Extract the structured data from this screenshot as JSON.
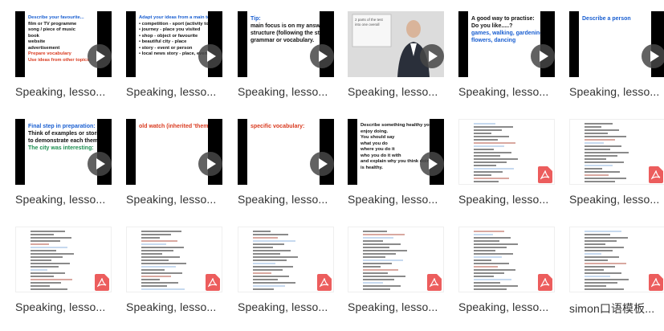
{
  "colors": {
    "blue": "#1a5fd1",
    "red": "#d93a1f",
    "green": "#1e8f52",
    "pdf": "#ec5d5d"
  },
  "items": [
    {
      "caption": "Speaking, lesso...",
      "type": "video",
      "slide": [
        {
          "t": "Describe your favourite...",
          "c": "blue"
        },
        {
          "t": " film or TV programme",
          "c": "black"
        },
        {
          "t": " song / piece of music",
          "c": "black"
        },
        {
          "t": " book",
          "c": "black"
        },
        {
          "t": " website",
          "c": "black"
        },
        {
          "t": " advertisement",
          "c": "black"
        },
        {
          "t": "Prepare vocabulary",
          "c": "red"
        },
        {
          "t": "Use ideas from other topics",
          "c": "red"
        }
      ]
    },
    {
      "caption": "Speaking, lesso...",
      "type": "video",
      "slide": [
        {
          "t": "Adapt your ideas from a main topic",
          "c": "blue"
        },
        {
          "t": "• competition - sport (activity topic)",
          "c": "black"
        },
        {
          "t": "• journey - place you visited",
          "c": "black"
        },
        {
          "t": "• shop - object or favourite",
          "c": "black"
        },
        {
          "t": "• beautiful city - place",
          "c": "black"
        },
        {
          "t": "• story - event or person",
          "c": "black"
        },
        {
          "t": "• local news story - place, event",
          "c": "black"
        }
      ]
    },
    {
      "caption": "Speaking, lesso...",
      "type": "video",
      "slide": [
        {
          "t": "Tip:",
          "c": "blue"
        },
        {
          "t": "main focus is on my answer",
          "c": "black"
        },
        {
          "t": "structure (following the steps), not",
          "c": "black"
        },
        {
          "t": "grammar or vocabulary.",
          "c": "black"
        }
      ]
    },
    {
      "caption": "Speaking, lesso...",
      "type": "person",
      "slide": [
        {
          "t": "2 parts of the test",
          "c": "black"
        },
        {
          "t": "into one overall",
          "c": "black"
        }
      ]
    },
    {
      "caption": "Speaking, lesso...",
      "type": "video",
      "slide": [
        {
          "t": "A good way to practise:",
          "c": "black"
        },
        {
          "t": "Do you like.....?",
          "c": "black"
        },
        {
          "t": "games, walking, gardening,",
          "c": "blue"
        },
        {
          "t": "flowers, dancing",
          "c": "blue"
        }
      ]
    },
    {
      "caption": "Speaking, lesso...",
      "type": "video",
      "slide": [
        {
          "t": "Describe a person",
          "c": "blue"
        }
      ]
    },
    {
      "caption": "Speaking, lesso...",
      "type": "video",
      "slide": [
        {
          "t": "Final step in preparation:",
          "c": "blue"
        },
        {
          "t": "Think of examples or stories",
          "c": "black"
        },
        {
          "t": "to demonstrate each theme",
          "c": "black"
        },
        {
          "t": "The city was interesting:",
          "c": "green"
        }
      ]
    },
    {
      "caption": "Speaking, lesso...",
      "type": "video",
      "slide": [
        {
          "t": "old watch (inherited 'theme')",
          "c": "red"
        }
      ]
    },
    {
      "caption": "Speaking, lesso...",
      "type": "video",
      "slide": [
        {
          "t": "specific vocabulary:",
          "c": "red"
        }
      ]
    },
    {
      "caption": "Speaking, lesso...",
      "type": "video",
      "slide": [
        {
          "t": "Describe something healthy you",
          "c": "black"
        },
        {
          "t": "enjoy doing.",
          "c": "black"
        },
        {
          "t": "You should say",
          "c": "black"
        },
        {
          "t": "  what you do",
          "c": "black"
        },
        {
          "t": "  where you do it",
          "c": "black"
        },
        {
          "t": "  who you do it with",
          "c": "black"
        },
        {
          "t": "and explain why you think doing it",
          "c": "black"
        },
        {
          "t": "is healthy.",
          "c": "black"
        }
      ]
    },
    {
      "caption": "Speaking, lesso...",
      "type": "pdf"
    },
    {
      "caption": "Speaking, lesso...",
      "type": "pdf"
    },
    {
      "caption": "Speaking, lesso...",
      "type": "pdf"
    },
    {
      "caption": "Speaking, lesso...",
      "type": "pdf"
    },
    {
      "caption": "Speaking, lesso...",
      "type": "pdf"
    },
    {
      "caption": "Speaking, lesso...",
      "type": "pdf"
    },
    {
      "caption": "Speaking, lesso...",
      "type": "pdf"
    },
    {
      "caption": "simon口语模板...",
      "type": "pdf"
    }
  ]
}
